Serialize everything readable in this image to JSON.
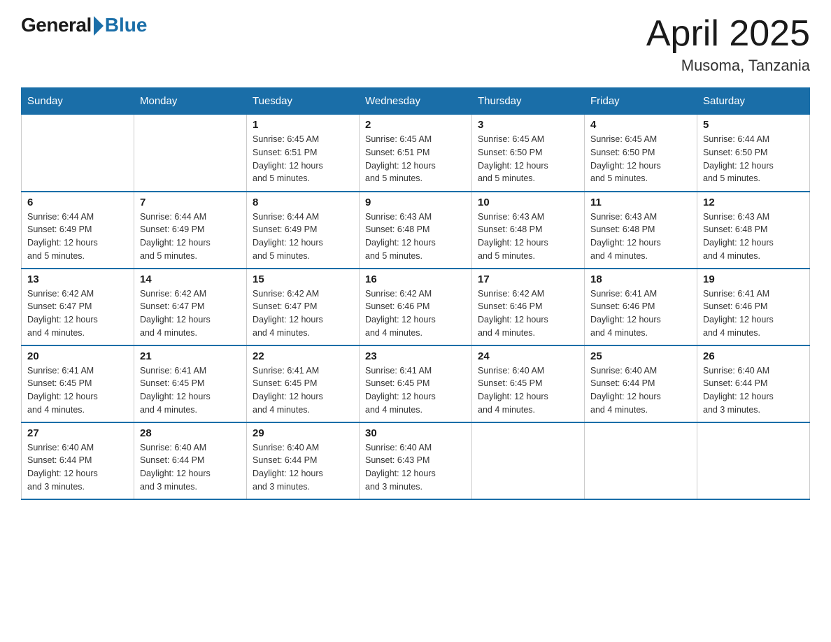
{
  "logo": {
    "general": "General",
    "blue": "Blue"
  },
  "title": "April 2025",
  "subtitle": "Musoma, Tanzania",
  "days_of_week": [
    "Sunday",
    "Monday",
    "Tuesday",
    "Wednesday",
    "Thursday",
    "Friday",
    "Saturday"
  ],
  "weeks": [
    [
      {
        "day": "",
        "info": ""
      },
      {
        "day": "",
        "info": ""
      },
      {
        "day": "1",
        "info": "Sunrise: 6:45 AM\nSunset: 6:51 PM\nDaylight: 12 hours\nand 5 minutes."
      },
      {
        "day": "2",
        "info": "Sunrise: 6:45 AM\nSunset: 6:51 PM\nDaylight: 12 hours\nand 5 minutes."
      },
      {
        "day": "3",
        "info": "Sunrise: 6:45 AM\nSunset: 6:50 PM\nDaylight: 12 hours\nand 5 minutes."
      },
      {
        "day": "4",
        "info": "Sunrise: 6:45 AM\nSunset: 6:50 PM\nDaylight: 12 hours\nand 5 minutes."
      },
      {
        "day": "5",
        "info": "Sunrise: 6:44 AM\nSunset: 6:50 PM\nDaylight: 12 hours\nand 5 minutes."
      }
    ],
    [
      {
        "day": "6",
        "info": "Sunrise: 6:44 AM\nSunset: 6:49 PM\nDaylight: 12 hours\nand 5 minutes."
      },
      {
        "day": "7",
        "info": "Sunrise: 6:44 AM\nSunset: 6:49 PM\nDaylight: 12 hours\nand 5 minutes."
      },
      {
        "day": "8",
        "info": "Sunrise: 6:44 AM\nSunset: 6:49 PM\nDaylight: 12 hours\nand 5 minutes."
      },
      {
        "day": "9",
        "info": "Sunrise: 6:43 AM\nSunset: 6:48 PM\nDaylight: 12 hours\nand 5 minutes."
      },
      {
        "day": "10",
        "info": "Sunrise: 6:43 AM\nSunset: 6:48 PM\nDaylight: 12 hours\nand 5 minutes."
      },
      {
        "day": "11",
        "info": "Sunrise: 6:43 AM\nSunset: 6:48 PM\nDaylight: 12 hours\nand 4 minutes."
      },
      {
        "day": "12",
        "info": "Sunrise: 6:43 AM\nSunset: 6:48 PM\nDaylight: 12 hours\nand 4 minutes."
      }
    ],
    [
      {
        "day": "13",
        "info": "Sunrise: 6:42 AM\nSunset: 6:47 PM\nDaylight: 12 hours\nand 4 minutes."
      },
      {
        "day": "14",
        "info": "Sunrise: 6:42 AM\nSunset: 6:47 PM\nDaylight: 12 hours\nand 4 minutes."
      },
      {
        "day": "15",
        "info": "Sunrise: 6:42 AM\nSunset: 6:47 PM\nDaylight: 12 hours\nand 4 minutes."
      },
      {
        "day": "16",
        "info": "Sunrise: 6:42 AM\nSunset: 6:46 PM\nDaylight: 12 hours\nand 4 minutes."
      },
      {
        "day": "17",
        "info": "Sunrise: 6:42 AM\nSunset: 6:46 PM\nDaylight: 12 hours\nand 4 minutes."
      },
      {
        "day": "18",
        "info": "Sunrise: 6:41 AM\nSunset: 6:46 PM\nDaylight: 12 hours\nand 4 minutes."
      },
      {
        "day": "19",
        "info": "Sunrise: 6:41 AM\nSunset: 6:46 PM\nDaylight: 12 hours\nand 4 minutes."
      }
    ],
    [
      {
        "day": "20",
        "info": "Sunrise: 6:41 AM\nSunset: 6:45 PM\nDaylight: 12 hours\nand 4 minutes."
      },
      {
        "day": "21",
        "info": "Sunrise: 6:41 AM\nSunset: 6:45 PM\nDaylight: 12 hours\nand 4 minutes."
      },
      {
        "day": "22",
        "info": "Sunrise: 6:41 AM\nSunset: 6:45 PM\nDaylight: 12 hours\nand 4 minutes."
      },
      {
        "day": "23",
        "info": "Sunrise: 6:41 AM\nSunset: 6:45 PM\nDaylight: 12 hours\nand 4 minutes."
      },
      {
        "day": "24",
        "info": "Sunrise: 6:40 AM\nSunset: 6:45 PM\nDaylight: 12 hours\nand 4 minutes."
      },
      {
        "day": "25",
        "info": "Sunrise: 6:40 AM\nSunset: 6:44 PM\nDaylight: 12 hours\nand 4 minutes."
      },
      {
        "day": "26",
        "info": "Sunrise: 6:40 AM\nSunset: 6:44 PM\nDaylight: 12 hours\nand 3 minutes."
      }
    ],
    [
      {
        "day": "27",
        "info": "Sunrise: 6:40 AM\nSunset: 6:44 PM\nDaylight: 12 hours\nand 3 minutes."
      },
      {
        "day": "28",
        "info": "Sunrise: 6:40 AM\nSunset: 6:44 PM\nDaylight: 12 hours\nand 3 minutes."
      },
      {
        "day": "29",
        "info": "Sunrise: 6:40 AM\nSunset: 6:44 PM\nDaylight: 12 hours\nand 3 minutes."
      },
      {
        "day": "30",
        "info": "Sunrise: 6:40 AM\nSunset: 6:43 PM\nDaylight: 12 hours\nand 3 minutes."
      },
      {
        "day": "",
        "info": ""
      },
      {
        "day": "",
        "info": ""
      },
      {
        "day": "",
        "info": ""
      }
    ]
  ]
}
